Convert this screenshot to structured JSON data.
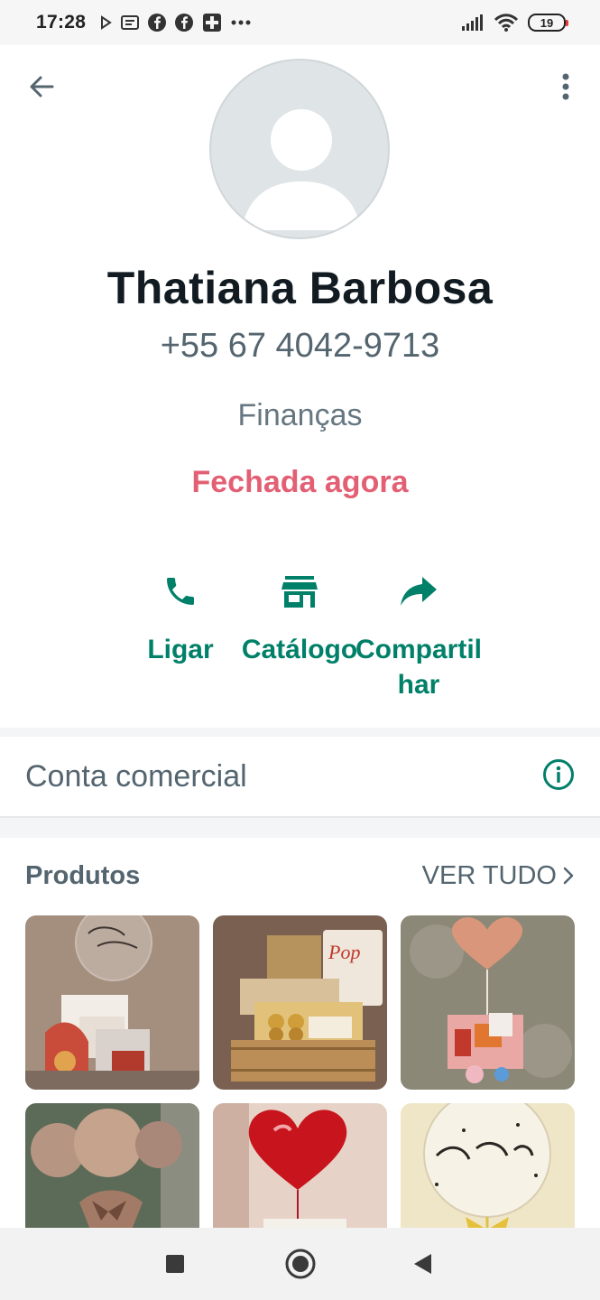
{
  "status_bar": {
    "time": "17:28",
    "battery": "19"
  },
  "contact": {
    "name": "Thatiana Barbosa",
    "phone": "+55 67 4042-9713",
    "category": "Finanças",
    "status": "Fechada agora"
  },
  "actions": [
    {
      "label": "Ligar",
      "icon": "phone-icon"
    },
    {
      "label": "Catálogo",
      "icon": "storefront-icon"
    },
    {
      "label": "Compartilhar",
      "icon": "share-icon"
    }
  ],
  "business": {
    "label": "Conta comercial",
    "icon": "info-icon"
  },
  "products": {
    "title": "Produtos",
    "see_all": "VER TUDO"
  },
  "colors": {
    "accent": "#008069",
    "status_closed": "#e35f74"
  }
}
